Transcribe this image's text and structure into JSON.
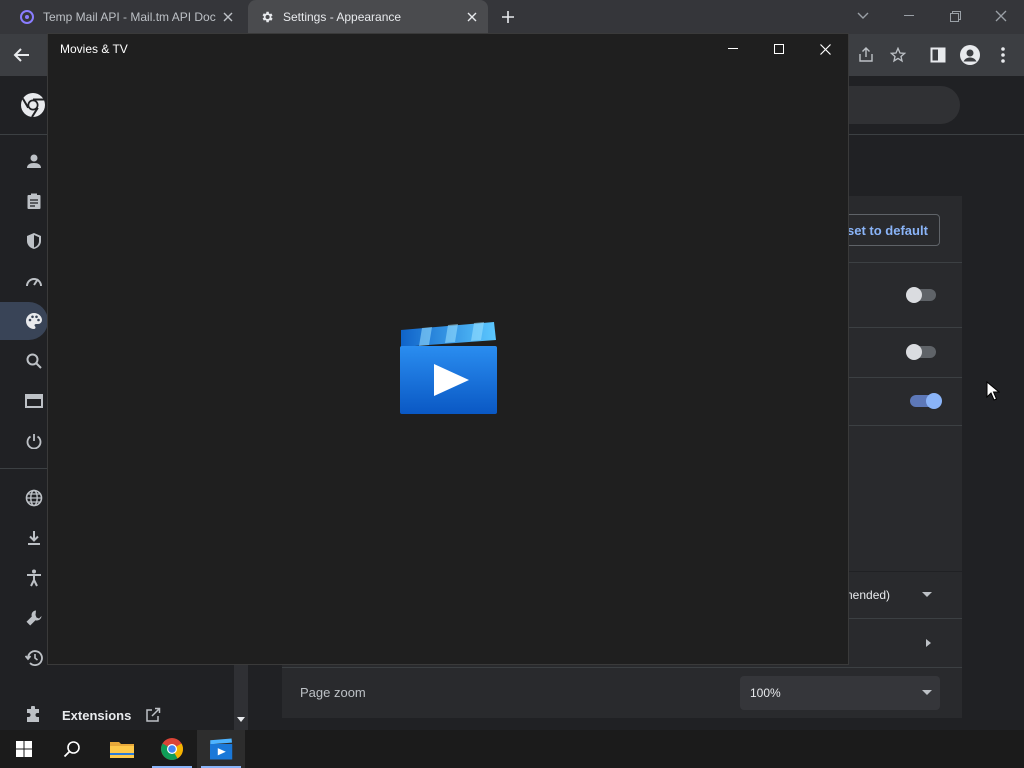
{
  "browser": {
    "tabs": [
      {
        "title": "Temp Mail API - Mail.tm API Doc",
        "icon": "mailtm-icon",
        "active": false
      },
      {
        "title": "Settings - Appearance",
        "icon": "gear-icon",
        "active": true
      }
    ],
    "window_controls": [
      "minimize",
      "restore",
      "close"
    ]
  },
  "settings": {
    "reset_label": "set to default",
    "font_size_value": "nended)",
    "page_zoom_label": "Page zoom",
    "page_zoom_value": "100%",
    "extensions_label": "Extensions",
    "toggles": [
      {
        "on": false
      },
      {
        "on": false
      },
      {
        "on": true
      }
    ],
    "sidebar_icons": [
      "person-icon",
      "clipboard-icon",
      "shield-icon",
      "speedometer-icon",
      "palette-icon",
      "search-icon",
      "browser-icon",
      "power-icon",
      "globe-icon",
      "download-icon",
      "accessibility-icon",
      "wrench-icon",
      "history-icon"
    ],
    "active_sidebar": "palette-icon"
  },
  "mtv": {
    "title": "Movies & TV",
    "logo": "movies-tv-logo"
  },
  "taskbar": {
    "items": [
      "start-icon",
      "search-icon",
      "file-explorer-icon",
      "chrome-icon",
      "movies-tv-icon"
    ],
    "active": "movies-tv-icon"
  },
  "colors": {
    "accent": "#8ab4f8",
    "tab_strip": "#35363a",
    "page_bg": "#202124",
    "movies_blue": "#1a78d8"
  }
}
